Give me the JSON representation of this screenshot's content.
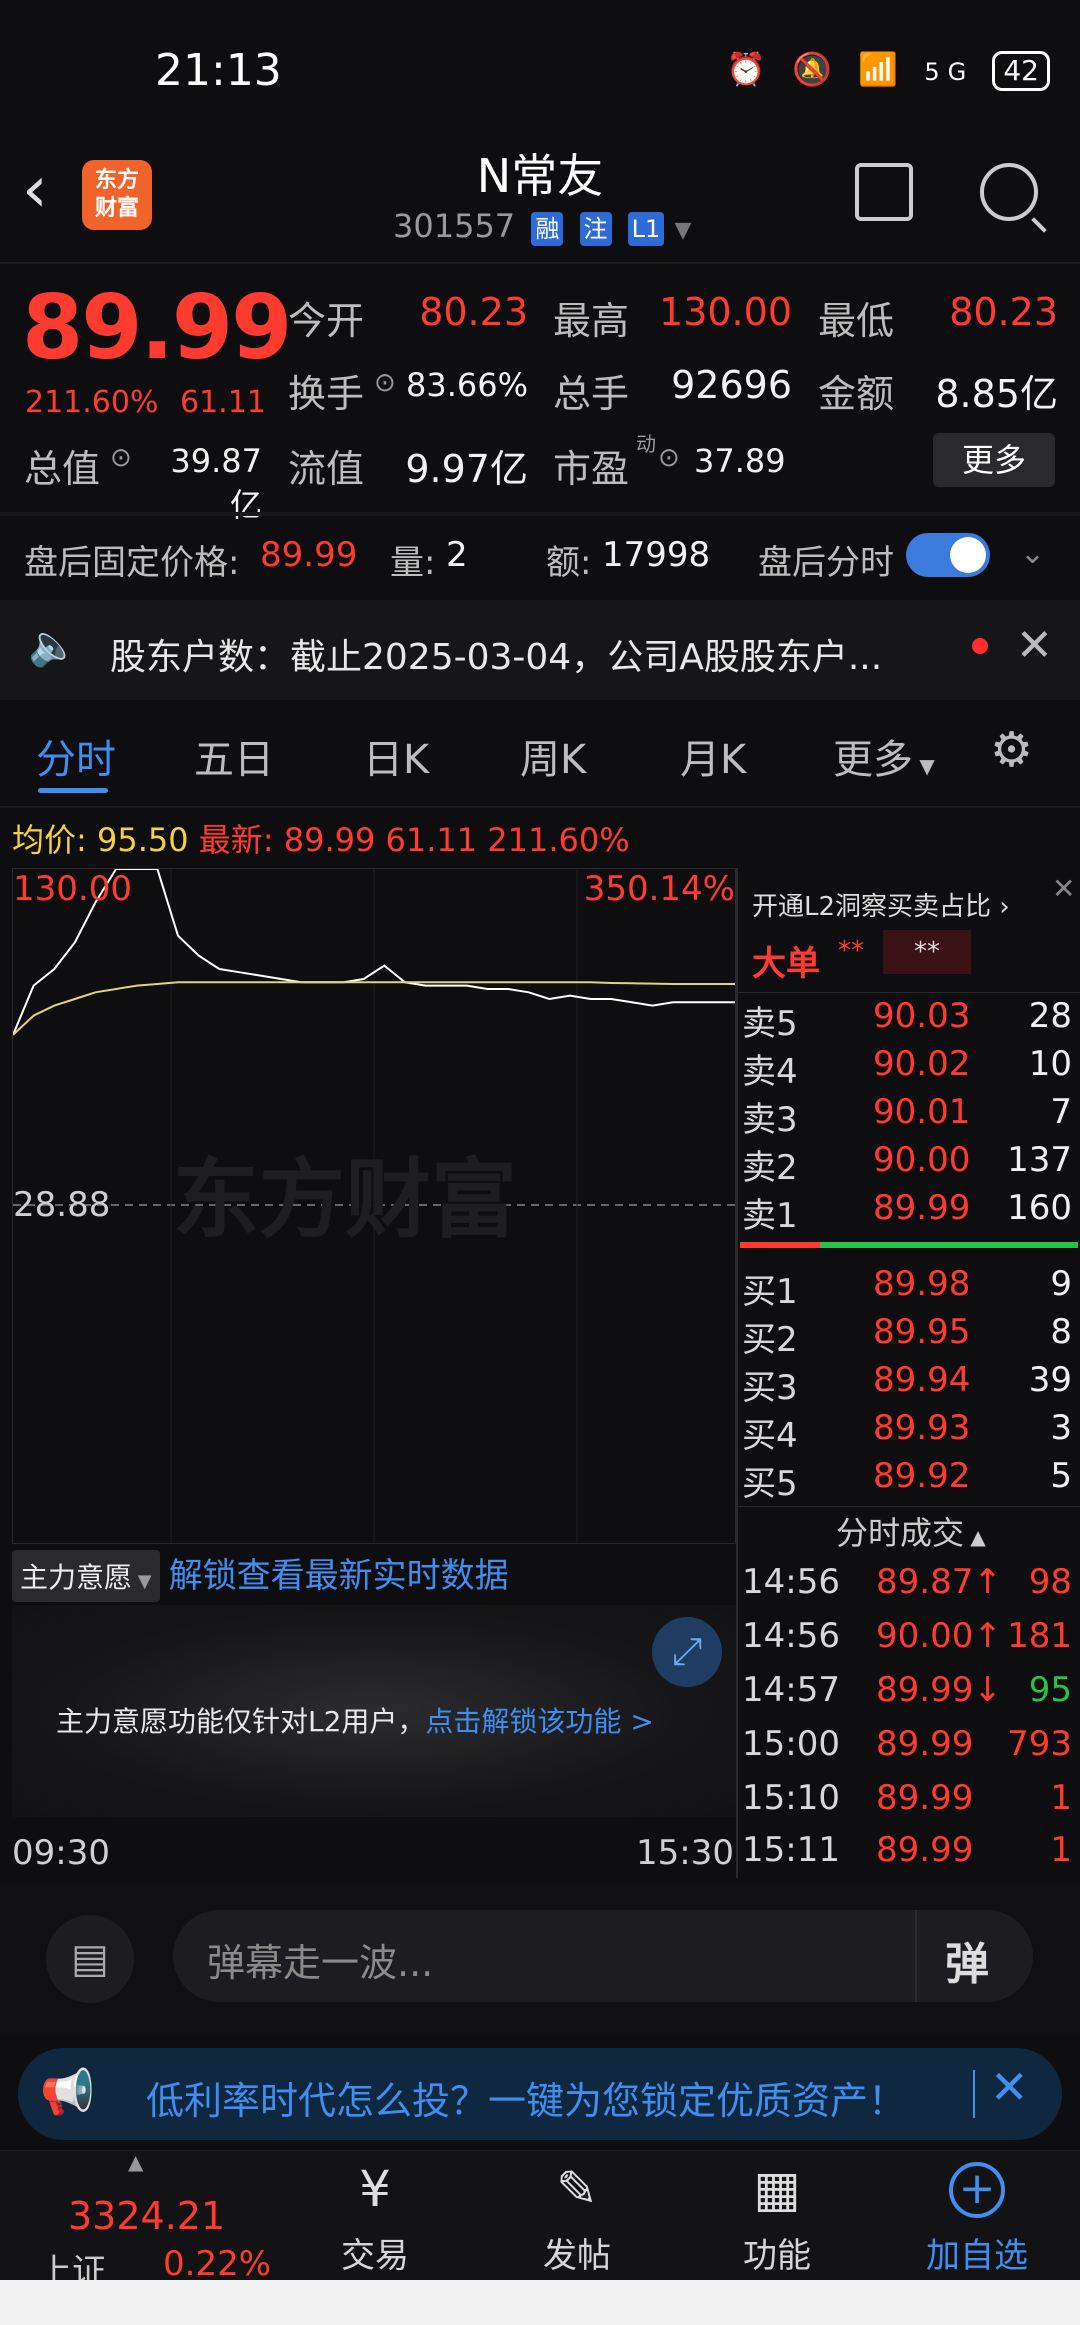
{
  "status_bar": {
    "time": "21:13",
    "network": "5G",
    "battery": "42"
  },
  "header": {
    "back": "‹",
    "logo_line1": "东方",
    "logo_line2": "财富",
    "title": "N常友",
    "code": "301557",
    "tags": [
      "融",
      "注",
      "L1"
    ]
  },
  "quote": {
    "price": "89.99",
    "change_pct": "211.60%",
    "change_amt": "61.11",
    "fields": [
      {
        "label": "今开",
        "value": "80.23",
        "color": "red"
      },
      {
        "label": "最高",
        "value": "130.00",
        "color": "red"
      },
      {
        "label": "最低",
        "value": "80.23",
        "color": "red"
      },
      {
        "label": "换手",
        "value": "83.66%",
        "color": "white"
      },
      {
        "label": "总手",
        "value": "92696",
        "color": "white"
      },
      {
        "label": "金额",
        "value": "8.85亿",
        "color": "white"
      },
      {
        "label": "总值",
        "value": "39.87亿",
        "color": "white"
      },
      {
        "label": "流值",
        "value": "9.97亿",
        "color": "white"
      },
      {
        "label": "市盈",
        "value": "37.89",
        "color": "white"
      }
    ],
    "pe_superscript": "动",
    "more_label": "更多"
  },
  "after_hours": {
    "price_label": "盘后固定价格:",
    "price": "89.99",
    "vol_label": "量:",
    "vol": "2",
    "amt_label": "额:",
    "amt": "17998",
    "toggle_label": "盘后分时",
    "toggle_on": true
  },
  "news": {
    "text": "股东户数：截止2025-03-04，公司A股股东户..."
  },
  "tabs": [
    "分时",
    "五日",
    "日K",
    "周K",
    "月K",
    "更多"
  ],
  "active_tab": "分时",
  "chart_header": {
    "avg_label": "均价:",
    "avg": "95.50",
    "latest_label": "最新:",
    "latest": "89.99",
    "chg": "61.11",
    "pct": "211.60%"
  },
  "chart_data": {
    "type": "line",
    "title": "",
    "xlabel": "",
    "ylabel": "",
    "x_ticks": [
      "09:30",
      "15:30"
    ],
    "y_top_label": "130.00",
    "y_mid_label": "28.88",
    "pct_top_label": "350.14%",
    "ylim": [
      -72.24,
      130.0
    ],
    "series": [
      {
        "color": "#ffffff",
        "values": [
          80.23,
          95,
          100,
          108,
          120,
          130,
          130,
          130,
          110,
          104,
          100,
          99,
          98,
          97,
          96,
          96,
          96,
          97,
          101,
          96,
          95,
          95,
          95,
          94,
          94,
          93,
          91,
          92,
          91,
          91,
          90,
          89,
          90,
          90,
          89.99,
          89.99
        ]
      },
      {
        "color": "#e6d27a",
        "values": [
          80.23,
          86,
          89,
          91,
          93,
          94,
          95,
          95.5,
          96,
          96,
          96,
          96,
          96,
          96,
          96,
          96,
          96,
          96,
          96,
          96,
          96,
          96,
          96,
          96,
          96,
          96,
          96,
          96,
          96,
          95.8,
          95.7,
          95.6,
          95.5,
          95.5,
          95.5,
          95.5
        ]
      }
    ],
    "watermark": "东方财富"
  },
  "order_book": {
    "l2_label": "开通L2洞察买卖占比 ›",
    "big_order_label": "大单",
    "big_order_v1": "**",
    "big_order_v2": "**",
    "asks": [
      {
        "label": "卖5",
        "price": "90.03",
        "vol": "28"
      },
      {
        "label": "卖4",
        "price": "90.02",
        "vol": "10"
      },
      {
        "label": "卖3",
        "price": "90.01",
        "vol": "7"
      },
      {
        "label": "卖2",
        "price": "90.00",
        "vol": "137"
      },
      {
        "label": "卖1",
        "price": "89.99",
        "vol": "160"
      }
    ],
    "bids": [
      {
        "label": "买1",
        "price": "89.98",
        "vol": "9"
      },
      {
        "label": "买2",
        "price": "89.95",
        "vol": "8"
      },
      {
        "label": "买3",
        "price": "89.94",
        "vol": "39"
      },
      {
        "label": "买4",
        "price": "89.93",
        "vol": "3"
      },
      {
        "label": "买5",
        "price": "89.92",
        "vol": "5"
      }
    ],
    "trades_title": "分时成交",
    "trades": [
      {
        "time": "14:56",
        "price": "89.87↑",
        "vol": "98",
        "vol_color": "#ff3b30"
      },
      {
        "time": "14:56",
        "price": "90.00↑",
        "vol": "181",
        "vol_color": "#ff3b30"
      },
      {
        "time": "14:57",
        "price": "89.99↓",
        "vol": "95",
        "vol_color": "#27c247"
      },
      {
        "time": "15:00",
        "price": "89.99",
        "vol": "793",
        "vol_color": "#ff3b30"
      },
      {
        "time": "15:10",
        "price": "89.99",
        "vol": "1",
        "vol_color": "#ff3b30"
      },
      {
        "time": "15:11",
        "price": "89.99",
        "vol": "1",
        "vol_color": "#ff3b30"
      }
    ]
  },
  "main_intent": {
    "selector": "主力意愿",
    "unlock_link": "解锁查看最新实时数据",
    "notice": "主力意愿功能仅针对L2用户，",
    "notice_link": "点击解锁该功能 >"
  },
  "time_axis": {
    "start": "09:30",
    "end": "15:30"
  },
  "comment": {
    "placeholder": "弹幕走一波...",
    "danmu_btn": "弹"
  },
  "ad": {
    "text": "低利率时代怎么投？一键为您锁定优质资产！"
  },
  "bottom_nav": {
    "index_value": "3324.21",
    "index_name": "上证",
    "index_pct": "0.22%",
    "items": [
      {
        "label": "交易",
        "icon": "yen-circle-icon"
      },
      {
        "label": "发帖",
        "icon": "edit-icon"
      },
      {
        "label": "功能",
        "icon": "grid-icon"
      },
      {
        "label": "加自选",
        "icon": "plus-circle-icon"
      }
    ]
  }
}
